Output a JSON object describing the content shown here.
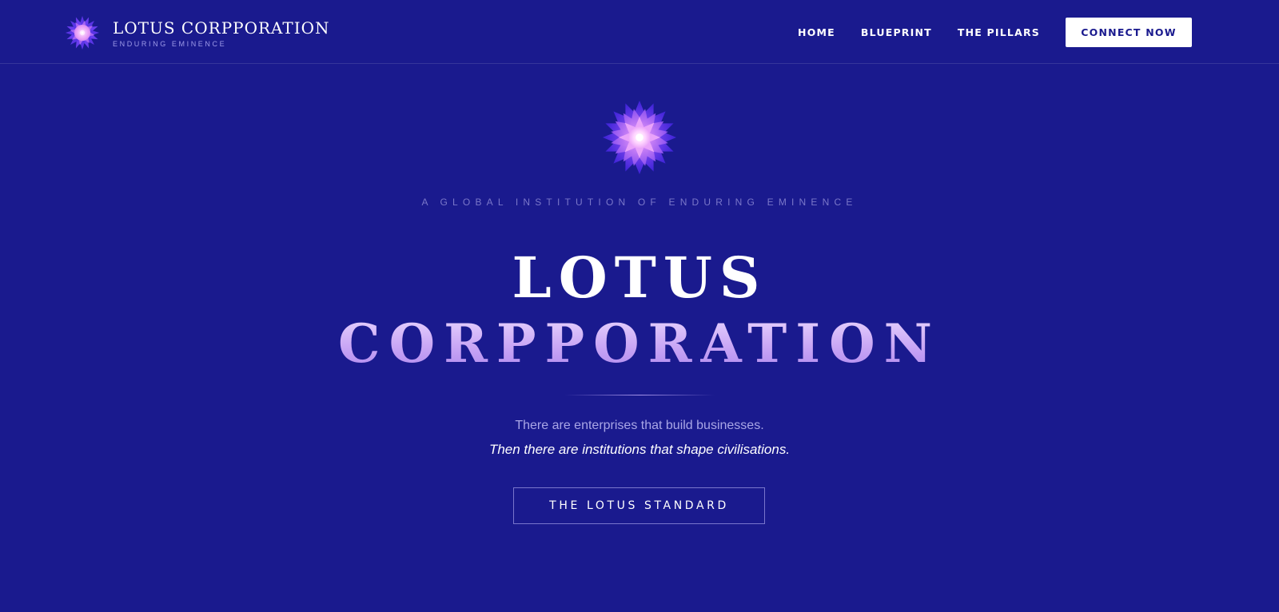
{
  "header": {
    "brand_name": "LOTUS CORPPORATION",
    "brand_tagline": "ENDURING EMINENCE",
    "logo_icon": "lotus-flower-icon",
    "nav": [
      {
        "label": "HOME"
      },
      {
        "label": "BLUEPRINT"
      },
      {
        "label": "THE PILLARS"
      }
    ],
    "cta_label": "CONNECT NOW"
  },
  "hero": {
    "logo_icon": "lotus-flower-icon",
    "eyebrow": "A GLOBAL INSTITUTION OF ENDURING EMINENCE",
    "title_line1": "LOTUS",
    "title_line2": "CORPPORATION",
    "lead_1": "There are enterprises that build businesses.",
    "lead_2": "Then there are institutions that shape civilisations.",
    "cta_label": "THE LOTUS STANDARD"
  },
  "colors": {
    "background": "#1a1a8e",
    "accent_violet": "#a983ee",
    "accent_light": "#ecdcff",
    "button_bg": "#ffffff",
    "button_text": "#1a1a8e"
  }
}
